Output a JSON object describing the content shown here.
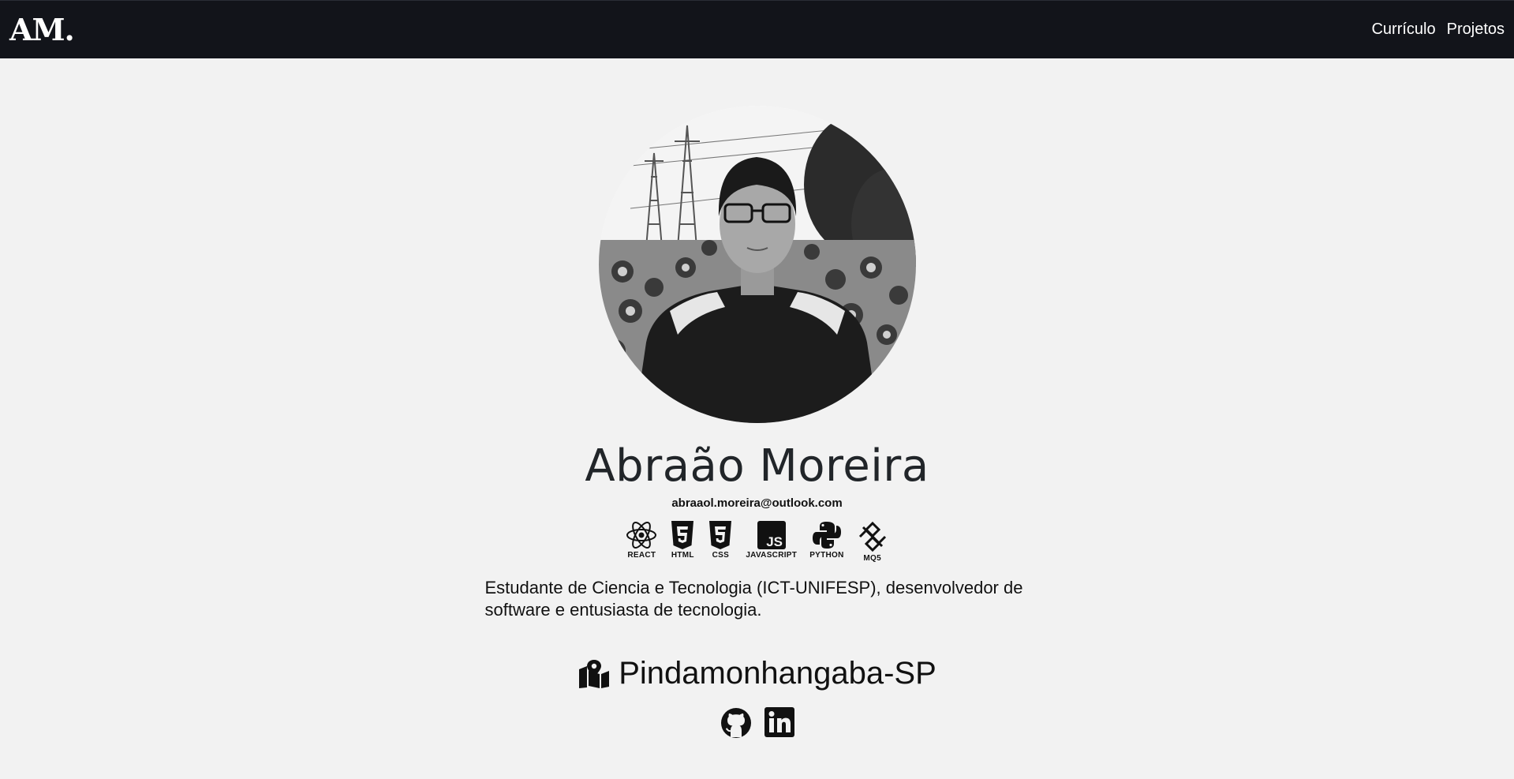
{
  "nav": {
    "brand": "AM.",
    "links": [
      {
        "label": "Currículo"
      },
      {
        "label": "Projetos"
      }
    ]
  },
  "profile": {
    "name": "Abraão Moreira",
    "email": "abraaol.moreira@outlook.com",
    "description": "Estudante de Ciencia e Tecnologia (ICT-UNIFESP), desenvolvedor de software e entusiasta de tecnologia.",
    "location": "Pindamonhangaba-SP"
  },
  "tech": [
    {
      "label": "REACT",
      "icon": "react-icon"
    },
    {
      "label": "HTML",
      "icon": "html5-icon"
    },
    {
      "label": "CSS",
      "icon": "css3-icon"
    },
    {
      "label": "JAVASCRIPT",
      "icon": "javascript-icon"
    },
    {
      "label": "PYTHON",
      "icon": "python-icon"
    },
    {
      "label": "MQ5",
      "icon": "mq5-icon"
    }
  ],
  "icons": {
    "location": "map-location-icon",
    "github": "github-icon",
    "linkedin": "linkedin-icon"
  },
  "colors": {
    "navbar": "#12141a",
    "background": "#f2f2f2",
    "text": "#212529"
  }
}
